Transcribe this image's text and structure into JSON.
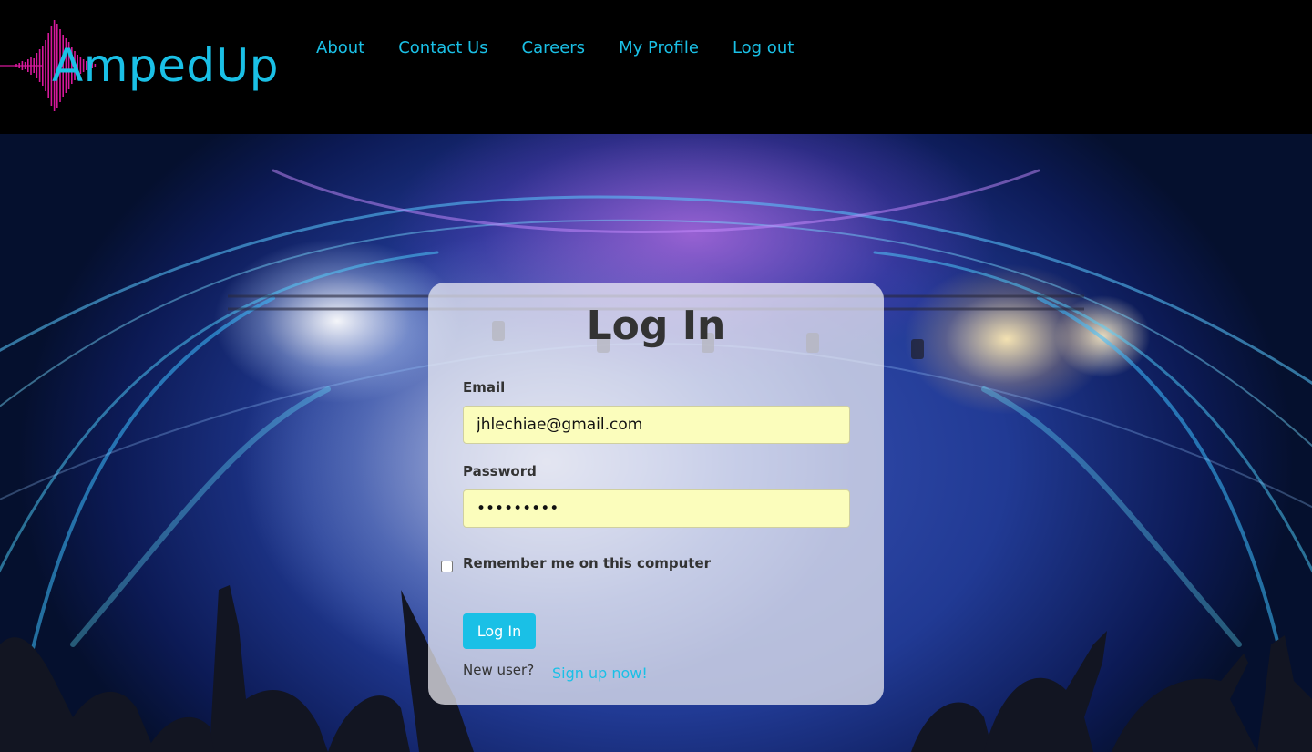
{
  "colors": {
    "accent": "#1ac0e6",
    "logo_wave": "#d6189b",
    "nav_link": "#1ac0e6",
    "autofill": "#fbfdbc"
  },
  "header": {
    "logo_text": "AmpedUp",
    "nav": [
      {
        "label": "About"
      },
      {
        "label": "Contact Us"
      },
      {
        "label": "Careers"
      },
      {
        "label": "My Profile"
      },
      {
        "label": "Log out"
      }
    ]
  },
  "login": {
    "title": "Log In",
    "email_label": "Email",
    "email_value": "jhlechiae@gmail.com",
    "password_label": "Password",
    "password_value": "•••••••••",
    "remember_label": "Remember me on this computer",
    "remember_checked": false,
    "submit_label": "Log In",
    "new_user_text": "New user?",
    "signup_label": "Sign up now!"
  },
  "icons": {
    "logo_wave": "sound-wave-icon"
  }
}
